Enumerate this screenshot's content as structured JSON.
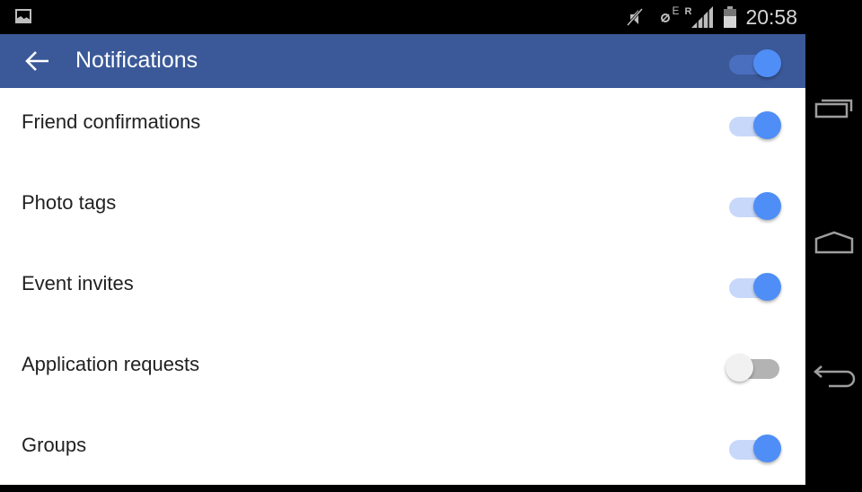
{
  "status_bar": {
    "time": "20:58",
    "network_type": "E",
    "roaming_indicator": "R",
    "icons": [
      "gallery-notification-icon",
      "mute-icon",
      "data-saver-icon",
      "signal-icon",
      "battery-icon"
    ]
  },
  "app_bar": {
    "title": "Notifications",
    "master_toggle_on": true
  },
  "settings": [
    {
      "label": "Friend confirmations",
      "enabled": true
    },
    {
      "label": "Photo tags",
      "enabled": true
    },
    {
      "label": "Event invites",
      "enabled": true
    },
    {
      "label": "Application requests",
      "enabled": false
    },
    {
      "label": "Groups",
      "enabled": true
    }
  ],
  "colors": {
    "app_bar": "#3b5998",
    "toggle_on_thumb": "#4f8ef7",
    "toggle_on_track": "#c8d8fb",
    "toggle_off_thumb": "#f1f1f1",
    "toggle_off_track": "#b3b3b3"
  },
  "nav_bar": {
    "buttons": [
      "recents",
      "home",
      "back"
    ]
  }
}
